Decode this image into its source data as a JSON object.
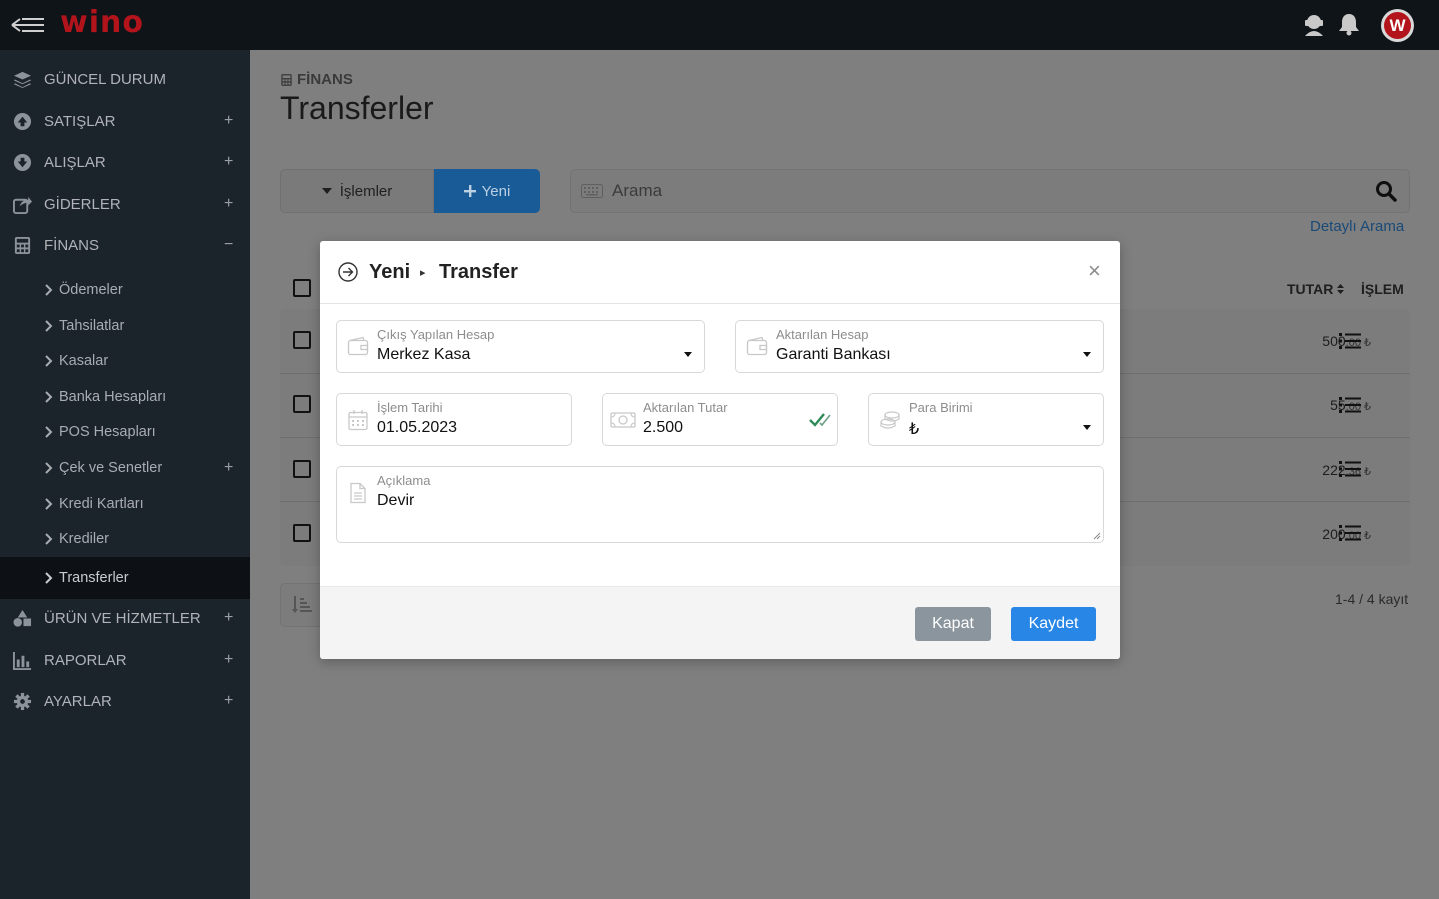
{
  "topbar": {
    "logo": "wino",
    "icons": [
      "support-icon",
      "bell-icon"
    ],
    "avatar_letter": "W"
  },
  "sidebar": {
    "items": [
      {
        "label": "GÜNCEL DURUM",
        "icon": "layers-icon",
        "toggle": ""
      },
      {
        "label": "SATIŞLAR",
        "icon": "upload-circle-icon",
        "toggle": "+"
      },
      {
        "label": "ALIŞLAR",
        "icon": "download-circle-icon",
        "toggle": "+"
      },
      {
        "label": "GİDERLER",
        "icon": "share-box-icon",
        "toggle": "+"
      },
      {
        "label": "FİNANS",
        "icon": "calculator-icon",
        "toggle": "−"
      }
    ],
    "finans_sub": [
      {
        "label": "Ödemeler",
        "toggle": ""
      },
      {
        "label": "Tahsilatlar",
        "toggle": ""
      },
      {
        "label": "Kasalar",
        "toggle": ""
      },
      {
        "label": "Banka Hesapları",
        "toggle": ""
      },
      {
        "label": "POS Hesapları",
        "toggle": ""
      },
      {
        "label": "Çek ve Senetler",
        "toggle": "+"
      },
      {
        "label": "Kredi Kartları",
        "toggle": ""
      },
      {
        "label": "Krediler",
        "toggle": ""
      },
      {
        "label": "Transferler",
        "toggle": "",
        "active": true
      }
    ],
    "items_bottom": [
      {
        "label": "ÜRÜN VE HİZMETLER",
        "icon": "shapes-icon",
        "toggle": "+"
      },
      {
        "label": "RAPORLAR",
        "icon": "bar-chart-icon",
        "toggle": "+"
      },
      {
        "label": "AYARLAR",
        "icon": "gear-icon",
        "toggle": "+"
      }
    ]
  },
  "page": {
    "breadcrumb": "FİNANS",
    "title": "Transferler",
    "actions_label": "İşlemler",
    "new_label": "Yeni",
    "search_placeholder": "Arama",
    "detail_search": "Detaylı Arama",
    "columns": {
      "amount": "TUTAR",
      "action": "İŞLEM"
    },
    "rows": [
      {
        "amount_int": "500",
        "amount_dec": ",00 ₺"
      },
      {
        "amount_int": "55",
        "amount_dec": ",00 ₺"
      },
      {
        "amount_int": "222",
        "amount_dec": ",36 ₺"
      },
      {
        "amount_int": "200",
        "amount_dec": ",00 ₺"
      }
    ],
    "records": "1-4 / 4 kayıt"
  },
  "modal": {
    "title_new": "Yeni",
    "title_sep": "▸",
    "title_transfer": "Transfer",
    "close": "×",
    "source_account": {
      "label": "Çıkış Yapılan Hesap",
      "value": "Merkez Kasa"
    },
    "target_account": {
      "label": "Aktarılan Hesap",
      "value": "Garanti Bankası"
    },
    "date": {
      "label": "İşlem Tarihi",
      "value": "01.05.2023"
    },
    "amount": {
      "label": "Aktarılan Tutar",
      "value": "2.500"
    },
    "currency": {
      "label": "Para Birimi",
      "value": "₺"
    },
    "description": {
      "label": "Açıklama",
      "value": "Devir"
    },
    "cancel_label": "Kapat",
    "save_label": "Kaydet"
  },
  "colors": {
    "brand": "#b3141c",
    "primary": "#2887e6",
    "sidebar_bg": "#1b232b",
    "topbar_bg": "#0f1418",
    "success_check": "#2e8b57"
  }
}
